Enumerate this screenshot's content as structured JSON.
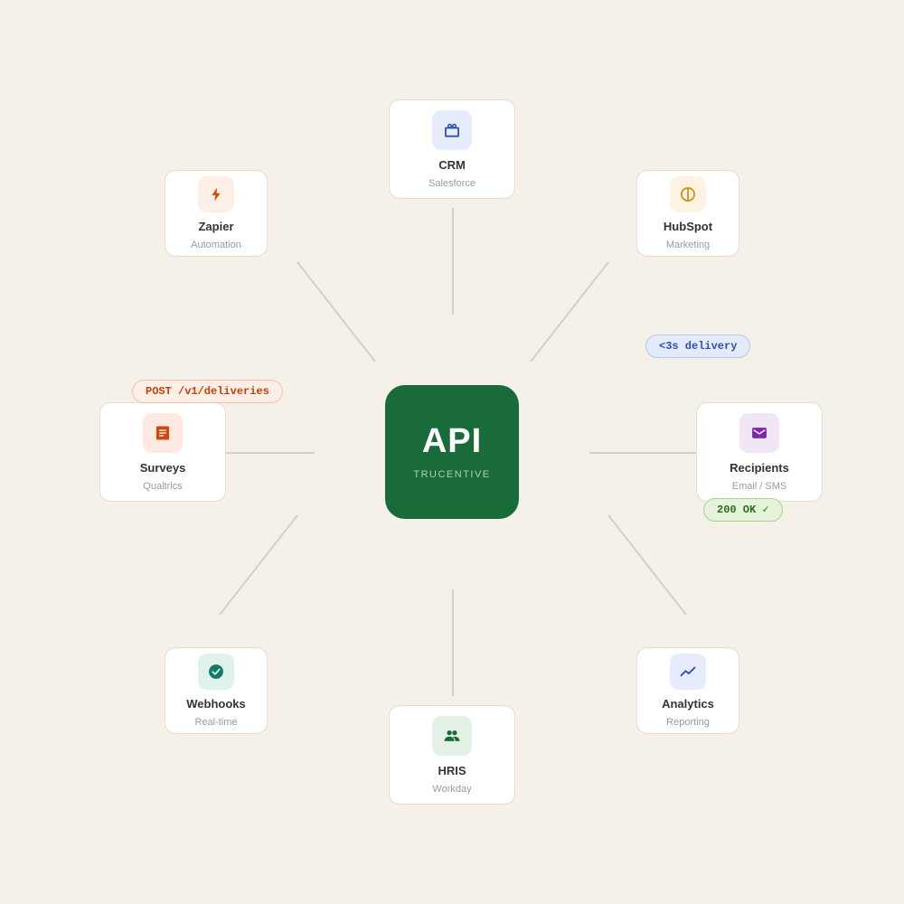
{
  "hub": {
    "title": "API",
    "subtitle": "TRUCENTIVE",
    "color": "#1a6b3a"
  },
  "nodes": [
    {
      "id": "crm",
      "title": "CRM",
      "subtitle": "Salesforce",
      "icon": "toolbox-icon",
      "icon_color": "#2d4fb0",
      "icon_bg": "#e6ecfb"
    },
    {
      "id": "hubspot",
      "title": "HubSpot",
      "subtitle": "Marketing",
      "icon": "circle-split-icon",
      "icon_color": "#c98a12",
      "icon_bg": "#fdf3e0"
    },
    {
      "id": "recipients",
      "title": "Recipients",
      "subtitle": "Email / SMS",
      "icon": "mail-icon",
      "icon_color": "#7a2aa6",
      "icon_bg": "#f0e6f6"
    },
    {
      "id": "analytics",
      "title": "Analytics",
      "subtitle": "Reporting",
      "icon": "trending-chart-icon",
      "icon_color": "#2d4fb0",
      "icon_bg": "#e6ecfb"
    },
    {
      "id": "hris",
      "title": "HRIS",
      "subtitle": "Workday",
      "icon": "people-icon",
      "icon_color": "#1a6b3a",
      "icon_bg": "#e3f1e7"
    },
    {
      "id": "webhooks",
      "title": "Webhooks",
      "subtitle": "Real-time",
      "icon": "check-circle-icon",
      "icon_color": "#137a6a",
      "icon_bg": "#dff2ee"
    },
    {
      "id": "surveys",
      "title": "Surveys",
      "subtitle": "Qualtrics",
      "icon": "document-icon",
      "icon_color": "#cc4a12",
      "icon_bg": "#fde9df"
    },
    {
      "id": "zapier",
      "title": "Zapier",
      "subtitle": "Automation",
      "icon": "bolt-icon",
      "icon_color": "#cc4a12",
      "icon_bg": "#fdeee6"
    }
  ],
  "badges": {
    "post": {
      "text": "POST /v1/deliveries",
      "color": "#c0400e",
      "bg": "#fdeee6",
      "border": "#f2c2aa"
    },
    "delivery": {
      "text": "<3s delivery",
      "color": "#2d4fb0",
      "bg": "#e3ebfa",
      "border": "#b7c7ec"
    },
    "ok": {
      "text": "200 OK ✓",
      "color": "#2f6b1c",
      "bg": "#e4f3d9",
      "border": "#a8d38e"
    }
  },
  "connector_color": "#d4cfc7"
}
